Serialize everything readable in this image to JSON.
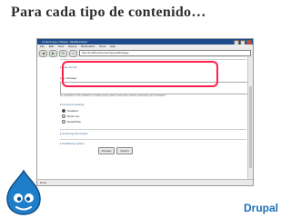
{
  "slide": {
    "title": "Para cada tipo de contenido…",
    "brand": "Drupal"
  },
  "browser": {
    "window_title": "Content type | Drupal - Mozilla Firefox",
    "menu": [
      "File",
      "Edit",
      "View",
      "History",
      "Bookmarks",
      "Tools",
      "Help"
    ],
    "url": "http://localhost/content/types/add/page",
    "status": "Done"
  },
  "form": {
    "input_format": "Input format",
    "log_label": "Log message:",
    "log_desc": "An explanation of the additions or updates being made to help other authors understand your motivations.",
    "comment_settings": {
      "legend": "Comment settings",
      "options": [
        "Disabled",
        "Read only",
        "Read/Write"
      ],
      "selected_index": 0
    },
    "authoring": "Authoring information",
    "publishing": "Publishing options",
    "preview_button": "Preview",
    "submit_button": "Submit"
  },
  "colors": {
    "highlight": "#ff1f4b",
    "titlebar": "#1d4b8c",
    "brand": "#1d6fb8"
  }
}
